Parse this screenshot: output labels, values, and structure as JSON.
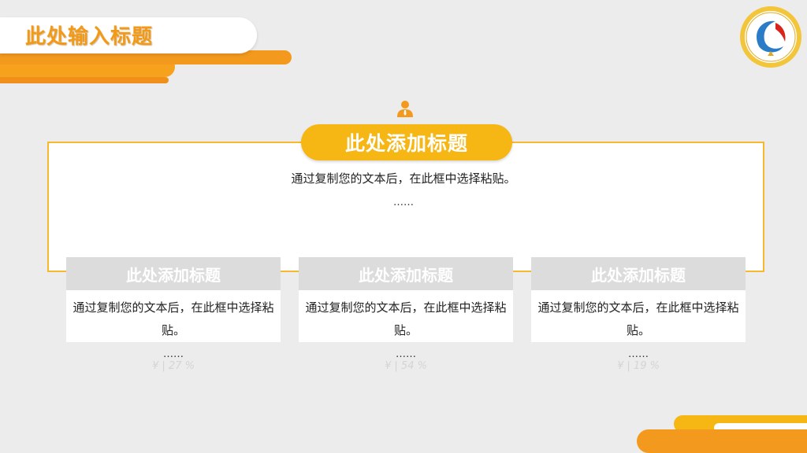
{
  "header": {
    "title": "此处输入标题"
  },
  "main": {
    "title": "此处添加标题",
    "text": "通过复制您的文本后，在此框中选择粘贴。",
    "dots": "……"
  },
  "cards": [
    {
      "title": "此处添加标题",
      "text": "通过复制您的文本后，在此框中选择粘贴。",
      "dots": "……",
      "stat": "¥ | 27 %"
    },
    {
      "title": "此处添加标题",
      "text": "通过复制您的文本后，在此框中选择粘贴。",
      "dots": "……",
      "stat": "¥ | 54 %"
    },
    {
      "title": "此处添加标题",
      "text": "通过复制您的文本后，在此框中选择粘贴。",
      "dots": "……",
      "stat": "¥ | 19 %"
    }
  ],
  "icons": {
    "logo": "university-seal-icon",
    "user": "user-icon"
  },
  "colors": {
    "accent": "#f6b614",
    "orange": "#f39a1e",
    "card_head": "#dcdcdc"
  }
}
